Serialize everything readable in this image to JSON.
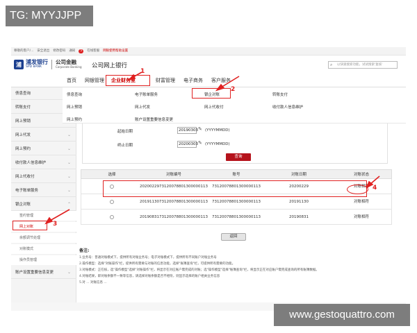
{
  "watermarks": {
    "top_left": "TG: MYYJJPP",
    "bottom_right": "www.gestoquattro.com"
  },
  "topbar": {
    "items": [
      "尊敬的客户/...",
      "安全退出",
      "修改密码",
      "通知",
      "5",
      "在线客服",
      "网银使用帮助设置"
    ]
  },
  "header": {
    "logo_cn": "浦发银行",
    "logo_en": "SPD BANK",
    "sub_cn": "公司金融",
    "sub_en": "Corporate Banking",
    "portal": "公司网上银行",
    "search_placeholder": "以快速搜索功能，试试搜索'复核'"
  },
  "nav": {
    "items": [
      "首页",
      "网银管理",
      "企业财务室",
      "财富管理",
      "电子商务",
      "客户服务"
    ],
    "active_index": 2
  },
  "dropdown": {
    "items": [
      "债息查询",
      "电子账单服务",
      "银企对账",
      "转账支付",
      "网上预销",
      "网上代发",
      "网上代收付",
      "收付款人信息维护",
      "网上预约",
      "账户设置重要信息变更"
    ]
  },
  "sidebar": {
    "items": [
      "债息查询",
      "转账支付",
      "网上预销",
      "网上代发",
      "网上预约",
      "收付款人信息维护",
      "网上代收付",
      "电子账单服务",
      "银企对账"
    ],
    "sub_items": [
      "签约管理",
      "网上对账",
      "余额调节处理",
      "对账模式",
      "操作员管理"
    ],
    "last_item": "账户设置重要信息变更"
  },
  "query": {
    "start_label": "起始日期",
    "start_value": "20190303",
    "end_label": "终止日期",
    "end_value": "20200303",
    "format": "(YYYYMMDD)",
    "button": "查询"
  },
  "table": {
    "headers": [
      "选择",
      "对账编号",
      "账号",
      "对账日期",
      "对账状态"
    ],
    "rows": [
      {
        "id": "2020022973120078801300000113",
        "account": "73120078801300000113",
        "date": "20200229",
        "status": "对账相符"
      },
      {
        "id": "2019113073120078801300000113",
        "account": "73120078801300000113",
        "date": "20191130",
        "status": "对账相符"
      },
      {
        "id": "2019083173120078801300000113",
        "account": "73120078801300000113",
        "date": "20190831",
        "status": "对账相符"
      }
    ],
    "back_button": "返回"
  },
  "notes": {
    "title": "备注:",
    "lines": [
      "1.业务号：普通对账模式下，提供所有对账业务号；电子对账模式下，提供所有不同账户对账业务号",
      "2.操作模型：选择\"对账操作\"栏，提供所有需要与对账的信息功能，选择\"账簿查询\"栏，可提供所有需要的功能。",
      "3.对账模式：正在核，选\"操作模型\"选择\"对账操作\"栏，将显示在对应账户需完成的对账；选\"操作模型\"选择\"账簿查询\"栏，将显示正在对应账户需完成查询的所有账簿数据。",
      "4.对账结果，即对账余额不一致等信息，请选择对账余额是否不相符，则显示选择的账户相关业务信息",
      "5.对 ... 对账信息 ..."
    ]
  },
  "annotations": [
    "1",
    "2",
    "3",
    "4"
  ],
  "colors": {
    "brand_blue": "#1b3f8f",
    "accent_red": "#b5121b",
    "annotation_red": "#e02020"
  }
}
